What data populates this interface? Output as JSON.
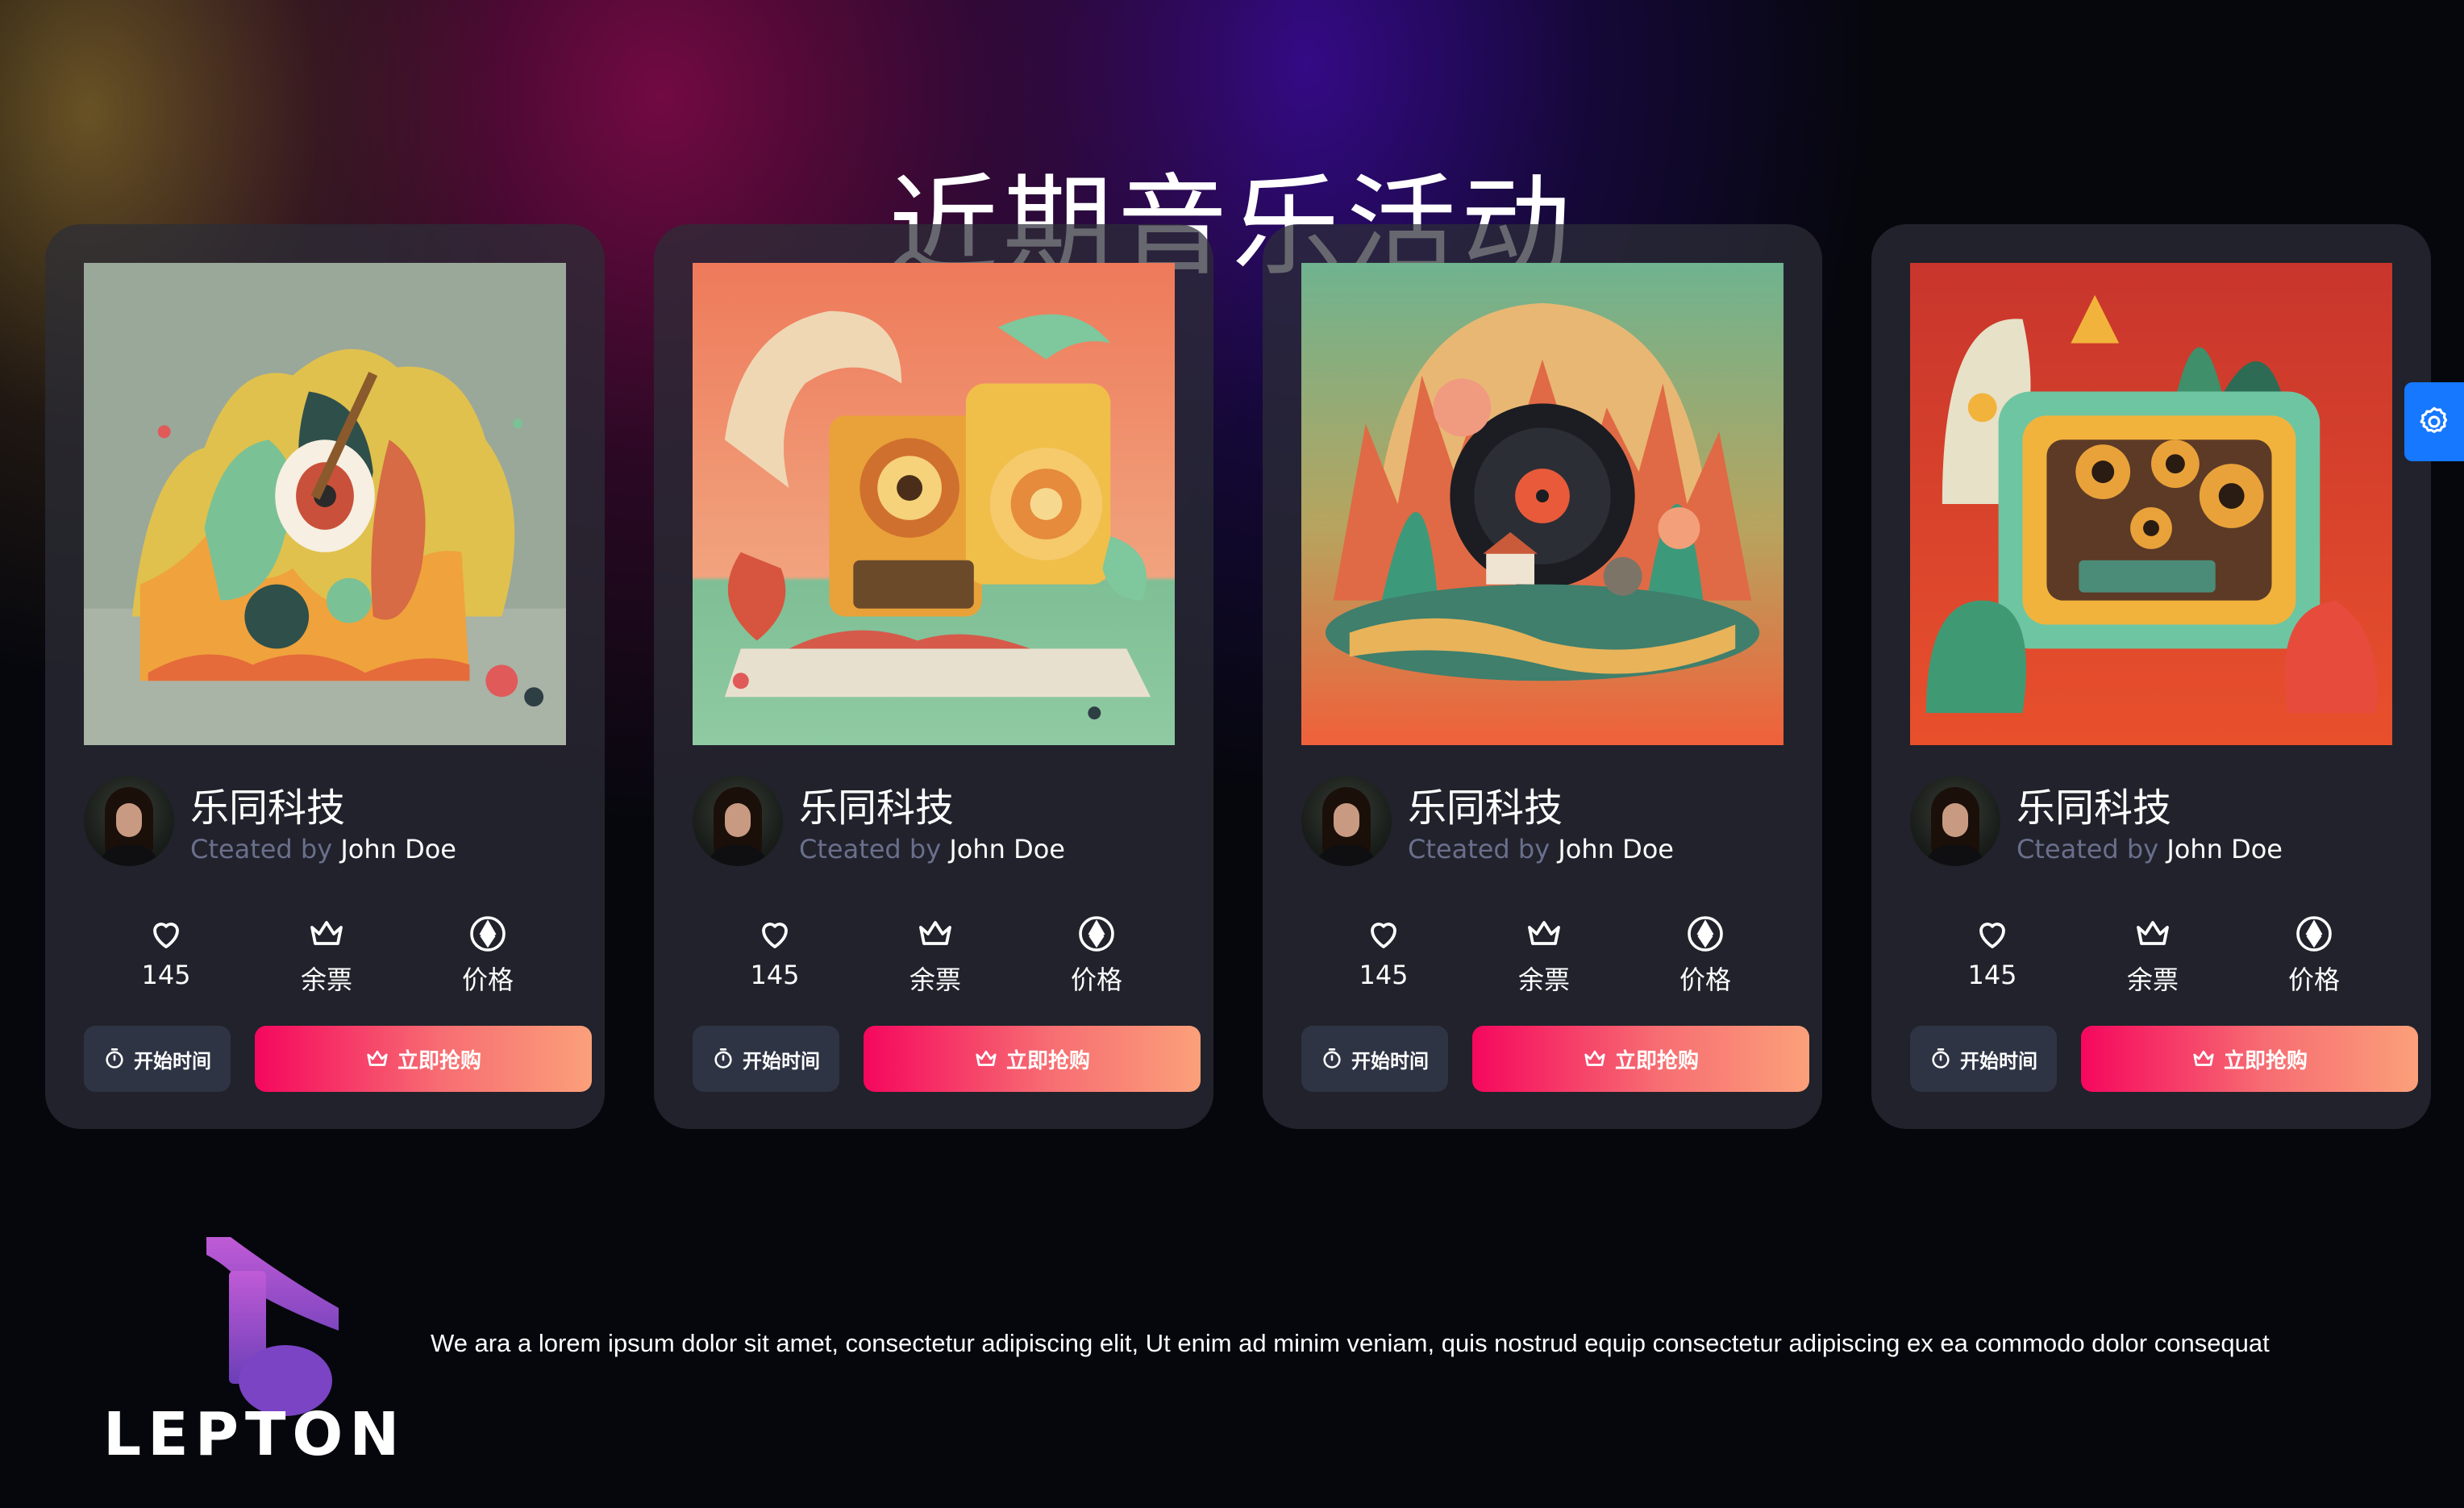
{
  "page": {
    "title": "近期音乐活动"
  },
  "cards": [
    {
      "art_name": "guitar-artwork",
      "creator": {
        "name": "乐同科技",
        "by_label": "Cteated by",
        "by_name": "John Doe"
      },
      "stats": {
        "likes": "145",
        "tickets": "余票",
        "price": "价格"
      },
      "buttons": {
        "time": "开始时间",
        "buy": "立即抢购"
      }
    },
    {
      "art_name": "speaker-artwork",
      "creator": {
        "name": "乐同科技",
        "by_label": "Cteated by",
        "by_name": "John Doe"
      },
      "stats": {
        "likes": "145",
        "tickets": "余票",
        "price": "价格"
      },
      "buttons": {
        "time": "开始时间",
        "buy": "立即抢购"
      }
    },
    {
      "art_name": "vinyl-artwork",
      "creator": {
        "name": "乐同科技",
        "by_label": "Cteated by",
        "by_name": "John Doe"
      },
      "stats": {
        "likes": "145",
        "tickets": "余票",
        "price": "价格"
      },
      "buttons": {
        "time": "开始时间",
        "buy": "立即抢购"
      }
    },
    {
      "art_name": "boombox-artwork",
      "creator": {
        "name": "乐同科技",
        "by_label": "Cteated by",
        "by_name": "John Doe"
      },
      "stats": {
        "likes": "145",
        "tickets": "余票",
        "price": "价格"
      },
      "buttons": {
        "time": "开始时间",
        "buy": "立即抢购"
      }
    }
  ],
  "icons": {
    "likes": "heart-icon",
    "tickets": "crown-icon",
    "price": "ethereum-icon",
    "time": "stopwatch-icon",
    "buy": "crown-icon",
    "settings": "gear-icon"
  },
  "colors": {
    "background": "#06070d",
    "card": "#2c2e38",
    "buy_gradient_start": "#f5075e",
    "buy_gradient_end": "#fba07a",
    "settings_accent": "#1677ff",
    "muted_text": "#6a6f8c"
  },
  "footer": {
    "logo_text": "LEPTON",
    "description": "We ara a lorem ipsum dolor sit amet, consectetur adipiscing elit, Ut enim ad minim veniam, quis nostrud equip consectetur adipiscing ex ea commodo dolor consequat"
  }
}
